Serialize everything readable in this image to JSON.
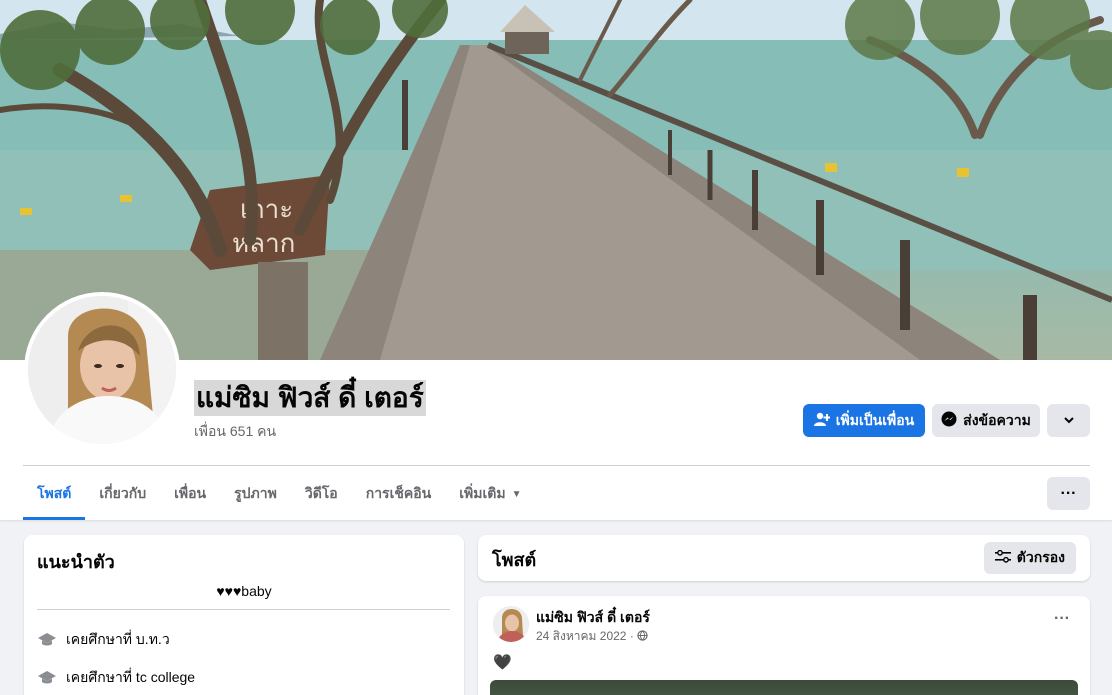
{
  "profile": {
    "name": "แม่ซิม ฟิวส์ ดี๋ เตอร์",
    "friends": "เพื่อน 651 คน"
  },
  "actions": {
    "add_friend": "เพิ่มเป็นเพื่อน",
    "message": "ส่งข้อความ"
  },
  "tabs": [
    {
      "label": "โพสต์",
      "active": true
    },
    {
      "label": "เกี่ยวกับ"
    },
    {
      "label": "เพื่อน"
    },
    {
      "label": "รูปภาพ"
    },
    {
      "label": "วิดีโอ"
    },
    {
      "label": "การเช็คอิน"
    },
    {
      "label": "เพิ่มเติม"
    }
  ],
  "intro": {
    "title": "แนะนำตัว",
    "bio": "♥♥♥baby",
    "items": [
      {
        "icon": "graduation-cap-icon",
        "text": "เคยศึกษาที่ บ.ท.ว"
      },
      {
        "icon": "graduation-cap-icon",
        "text": "เคยศึกษาที่ tc college"
      }
    ]
  },
  "posts_section": {
    "title": "โพสต์",
    "filter_label": "ตัวกรอง"
  },
  "post": {
    "author": "แม่ซิม ฟิวส์ ดี๋ เตอร์",
    "date": "24 สิงหาคม 2022 ·",
    "text": "🖤"
  },
  "colors": {
    "accent": "#1b74e4",
    "background": "#f0f2f5",
    "secondary_button": "#e4e6eb"
  }
}
